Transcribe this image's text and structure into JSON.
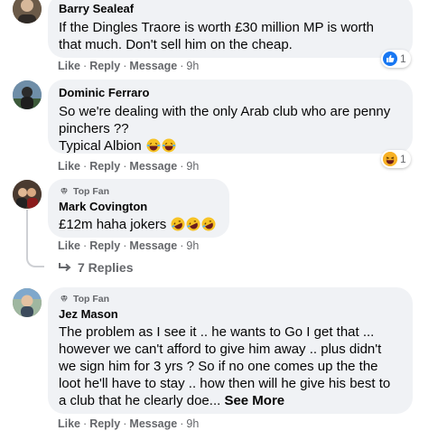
{
  "comments": [
    {
      "name": "Barry Sealeaf",
      "text_lines": [
        "If the Dingles Traore is worth £30 million MP is worth",
        "that much. Don't sell him on the cheap."
      ],
      "actions": {
        "like": "Like",
        "reply": "Reply",
        "message": "Message",
        "time": "9h"
      },
      "reaction": {
        "icon": "like-icon",
        "count": "1"
      }
    },
    {
      "name": "Dominic Ferraro",
      "text_lines": [
        "So we're dealing with the only Arab club who are penny",
        "pinchers ??",
        "Typical Albion"
      ],
      "actions": {
        "like": "Like",
        "reply": "Reply",
        "message": "Message",
        "time": "9h"
      },
      "reaction": {
        "icon": "haha-icon",
        "count": "1"
      }
    },
    {
      "badge": "Top Fan",
      "name": "Mark Covington",
      "text_lines": [
        "£12m haha jokers"
      ],
      "actions": {
        "like": "Like",
        "reply": "Reply",
        "message": "Message",
        "time": "9h"
      },
      "replies": "7 Replies"
    },
    {
      "badge": "Top Fan",
      "name": "Jez Mason",
      "text_lines": [
        "The problem as I see it .. he wants to Go I get that ...",
        "however we can't afford to give him away .. plus didn't",
        "we sign him for 3 yrs ? So if no one comes up the the",
        "loot he'll have to stay .. how then will he give his best to",
        "a club that he clearly doe..."
      ],
      "see_more": "See More",
      "actions": {
        "like": "Like",
        "reply": "Reply",
        "message": "Message",
        "time": "9h"
      }
    }
  ],
  "colors": {
    "bubble": "#f0f2f5",
    "meta": "#65676b",
    "like_blue": "#1877f2",
    "haha_yellow": "#f7b125"
  }
}
